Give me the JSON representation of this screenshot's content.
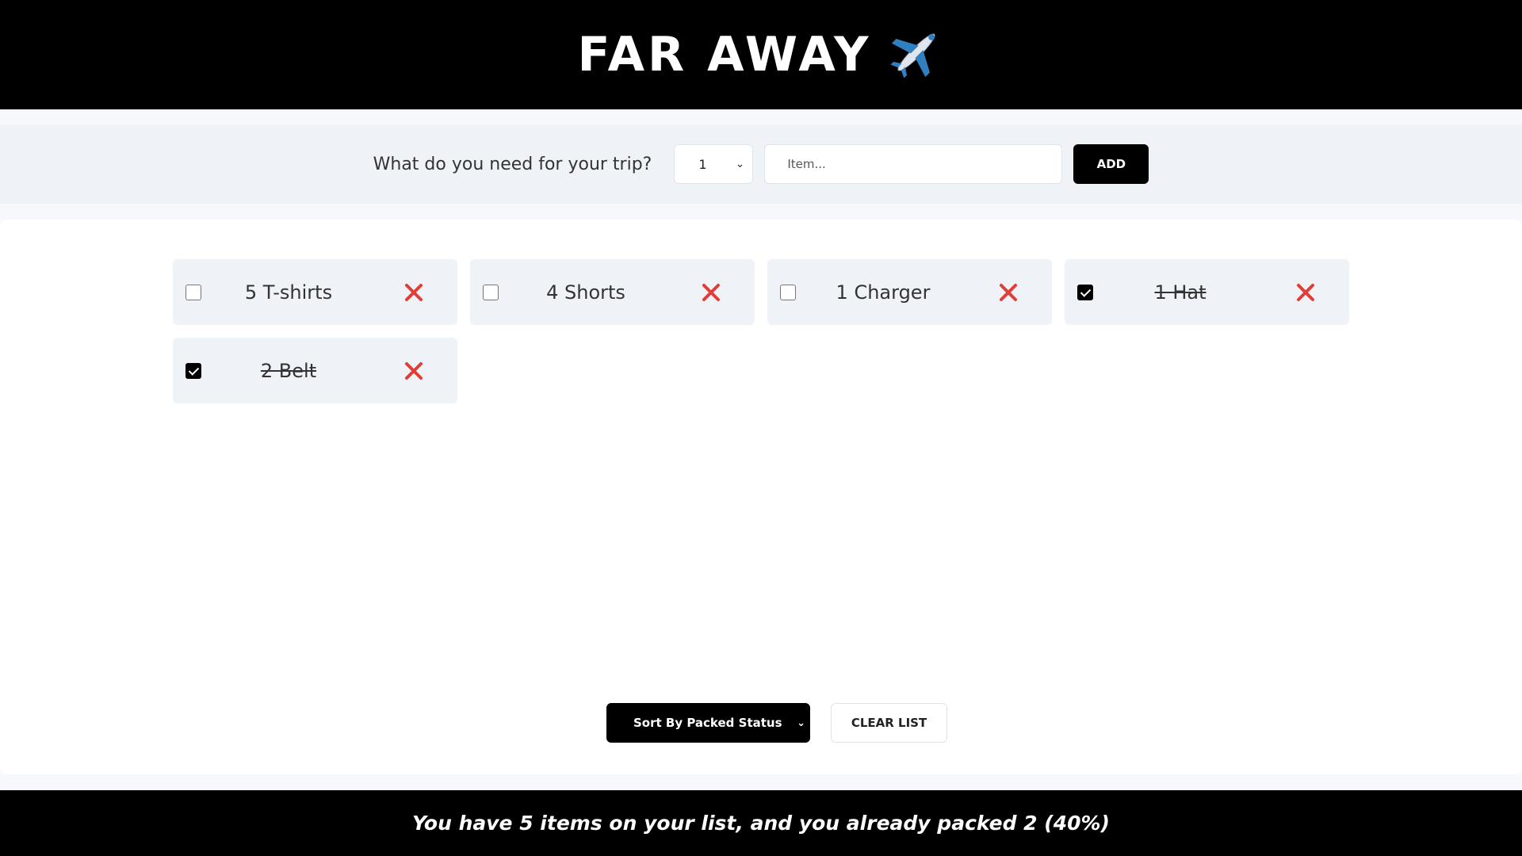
{
  "header": {
    "title": "FAR AWAY",
    "icon": "airplane-icon"
  },
  "form": {
    "prompt": "What do you need for your trip?",
    "quantity_selected": "1",
    "item_placeholder": "Item...",
    "item_value": "",
    "add_label": "ADD"
  },
  "items": [
    {
      "label": "5 T-shirts",
      "packed": false
    },
    {
      "label": "4 Shorts",
      "packed": false
    },
    {
      "label": "1 Charger",
      "packed": false
    },
    {
      "label": "1 Hat",
      "packed": true
    },
    {
      "label": "2 Belt",
      "packed": true
    }
  ],
  "actions": {
    "sort_selected": "Sort By Packed Status",
    "clear_label": "CLEAR LIST"
  },
  "footer": {
    "stats": "You have 5 items on your list, and you already packed 2 (40%)"
  },
  "colors": {
    "header_bg": "#000000",
    "delete": "#e03e36",
    "item_bg": "#eff2f7"
  }
}
